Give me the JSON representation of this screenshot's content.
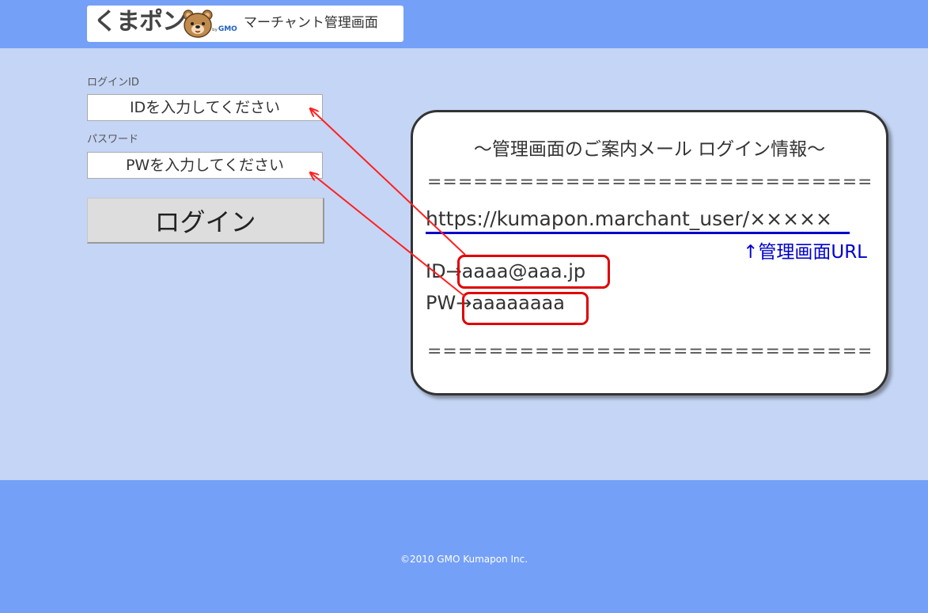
{
  "header": {
    "logo_text": "くまポン",
    "logo_by": "by",
    "logo_sub": "GMO",
    "app_title": "マーチャント管理画面"
  },
  "login": {
    "id_label": "ログインID",
    "id_placeholder": "IDを入力してください",
    "pw_label": "パスワード",
    "pw_placeholder": "PWを入力してください",
    "button_label": "ログイン"
  },
  "info_card": {
    "title": "～管理画面のご案内メール ログイン情報～",
    "separator": "================================",
    "url": "https://kumapon.marchant_user/×××××",
    "url_caption": "↑管理画面URL",
    "id_prefix": "ID→",
    "id_value": "aaaa@aaa.jp",
    "pw_prefix": "PW→",
    "pw_value": "aaaaaaaa"
  },
  "footer": {
    "copyright": "©2010 GMO Kumapon Inc."
  },
  "colors": {
    "header_bg": "#74a0f8",
    "page_bg": "#c5d5f5",
    "highlight": "#e00000",
    "link": "#0000cc"
  }
}
